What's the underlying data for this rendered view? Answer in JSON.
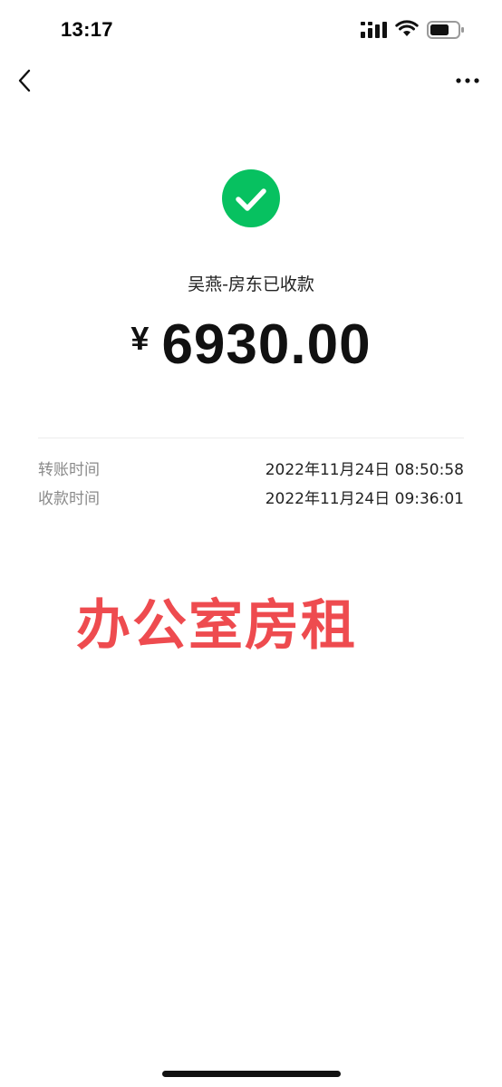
{
  "status_bar": {
    "time": "13:17"
  },
  "icons": {
    "back": "chevron-left-icon",
    "more": "more-horizontal-icon",
    "success": "check-circle-icon",
    "signal": "signal-icon",
    "wifi": "wifi-icon",
    "battery": "battery-icon"
  },
  "colors": {
    "success_green": "#07c160",
    "annotation_red": "#ee4b4f",
    "label_gray": "#8a8a8a"
  },
  "receipt": {
    "title": "吴燕-房东已收款",
    "currency": "¥",
    "amount": "6930.00"
  },
  "details": [
    {
      "label": "转账时间",
      "value": "2022年11月24日 08:50:58"
    },
    {
      "label": "收款时间",
      "value": "2022年11月24日 09:36:01"
    }
  ],
  "annotation": "办公室房租"
}
